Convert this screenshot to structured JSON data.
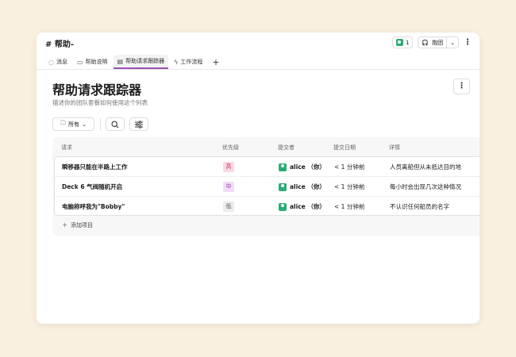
{
  "channel": {
    "name": "# 帮助-",
    "member_count": "1",
    "huddle_label": "抱团"
  },
  "tabs": [
    {
      "label": "消息",
      "icon": "message-icon"
    },
    {
      "label": "帮助说明",
      "icon": "canvas-icon"
    },
    {
      "label": "帮助请求跟踪器",
      "icon": "list-icon",
      "active": true
    },
    {
      "label": "工作流程",
      "icon": "workflow-icon"
    }
  ],
  "list": {
    "title": "帮助请求跟踪器",
    "description": "描述你的团队套餐如何使用这个列表",
    "filter_label": "所有",
    "add_item_label": "添加项目"
  },
  "columns": [
    "请求",
    "优先级",
    "提交者",
    "提交日期",
    "详情"
  ],
  "rows": [
    {
      "request": "瞬移器只能在半路上工作",
      "priority": "高",
      "priority_bg": "#fbd9e4",
      "priority_color": "#c0365f",
      "submitter": "alice （你）",
      "date": "< 1 分钟前",
      "details": "人员离船但从未抵达目的地"
    },
    {
      "request": "Deck 6 气阀随机开启",
      "priority": "中",
      "priority_bg": "#f2dcf8",
      "priority_color": "#9b3bb5",
      "submitter": "alice （你）",
      "date": "< 1 分钟前",
      "details": "每小时会出现几次这种情况"
    },
    {
      "request": "电脑称呼我为\"Bobby\"",
      "priority": "低",
      "priority_bg": "#ececec",
      "priority_color": "#555",
      "submitter": "alice （你）",
      "date": "< 1 分钟前",
      "details": "不认识任何船员的名字"
    }
  ]
}
